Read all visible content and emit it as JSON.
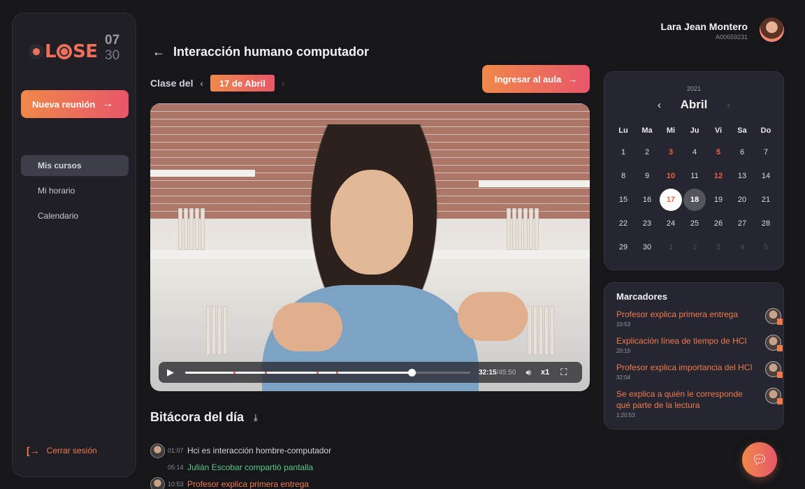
{
  "sidebar": {
    "logo_text": "CLOSE",
    "clock_hour": "07",
    "clock_minute": "30",
    "new_meeting_label": "Nueva reunión",
    "nav": [
      {
        "label": "Mis cursos",
        "active": true
      },
      {
        "label": "Mi horario",
        "active": false
      },
      {
        "label": "Calendario",
        "active": false
      }
    ],
    "logout_label": "Cerrar sesión"
  },
  "header": {
    "title": "Interacción humano computador",
    "class_label": "Clase del",
    "date": "17 de Abril",
    "enter_button": "Ingresar al aula"
  },
  "user": {
    "name": "Lara Jean Montero",
    "id": "A00659231"
  },
  "video": {
    "current_time": "32:15",
    "total_time": "/45:50",
    "speed": "x1",
    "progress_fraction": 0.794,
    "markers_fraction": [
      0.17,
      0.28,
      0.46,
      0.53
    ]
  },
  "log": {
    "title": "Bitácora del día",
    "entries": [
      {
        "time": "01:07",
        "text": "Hci es interacción hombre-computador",
        "style": "white",
        "avatar": true
      },
      {
        "time": "05:14",
        "text": "Julián Escobar compartió pantalla",
        "style": "green",
        "avatar": false
      },
      {
        "time": "10:53",
        "text": "Profesor explica primera entrega",
        "style": "orange",
        "avatar": true
      }
    ]
  },
  "calendar": {
    "year": "2021",
    "month": "Abril",
    "weekdays": [
      "Lu",
      "Ma",
      "Mi",
      "Ju",
      "Vi",
      "Sa",
      "Do"
    ],
    "days": [
      {
        "d": "1"
      },
      {
        "d": "2"
      },
      {
        "d": "3",
        "s": "hl"
      },
      {
        "d": "4"
      },
      {
        "d": "5",
        "s": "hl"
      },
      {
        "d": "6"
      },
      {
        "d": "7"
      },
      {
        "d": "8"
      },
      {
        "d": "9"
      },
      {
        "d": "10",
        "s": "hl"
      },
      {
        "d": "11"
      },
      {
        "d": "12",
        "s": "hl"
      },
      {
        "d": "13"
      },
      {
        "d": "14"
      },
      {
        "d": "15"
      },
      {
        "d": "16"
      },
      {
        "d": "17",
        "s": "today"
      },
      {
        "d": "18",
        "s": "sel"
      },
      {
        "d": "19"
      },
      {
        "d": "20"
      },
      {
        "d": "21"
      },
      {
        "d": "22"
      },
      {
        "d": "23"
      },
      {
        "d": "24"
      },
      {
        "d": "25"
      },
      {
        "d": "26"
      },
      {
        "d": "27"
      },
      {
        "d": "28"
      },
      {
        "d": "29"
      },
      {
        "d": "30"
      },
      {
        "d": "1",
        "s": "muted"
      },
      {
        "d": "2",
        "s": "muted"
      },
      {
        "d": "3",
        "s": "muted"
      },
      {
        "d": "4",
        "s": "muted"
      },
      {
        "d": "5",
        "s": "muted"
      }
    ]
  },
  "bookmarks": {
    "title": "Marcadores",
    "items": [
      {
        "text": "Profesor explica primera entrega",
        "time": "10:53"
      },
      {
        "text": "Explicación línea de tiempo de HCI",
        "time": "20:19"
      },
      {
        "text": "Profesor explica importancia del HCI",
        "time": "32:04"
      },
      {
        "text": "Se explica a quién le corresponde qué parte de la lectura",
        "time": "1:20:53"
      }
    ]
  },
  "colors": {
    "accent_start": "#f0894a",
    "accent_end": "#e8566a",
    "background": "#16161b",
    "card": "#262630"
  }
}
